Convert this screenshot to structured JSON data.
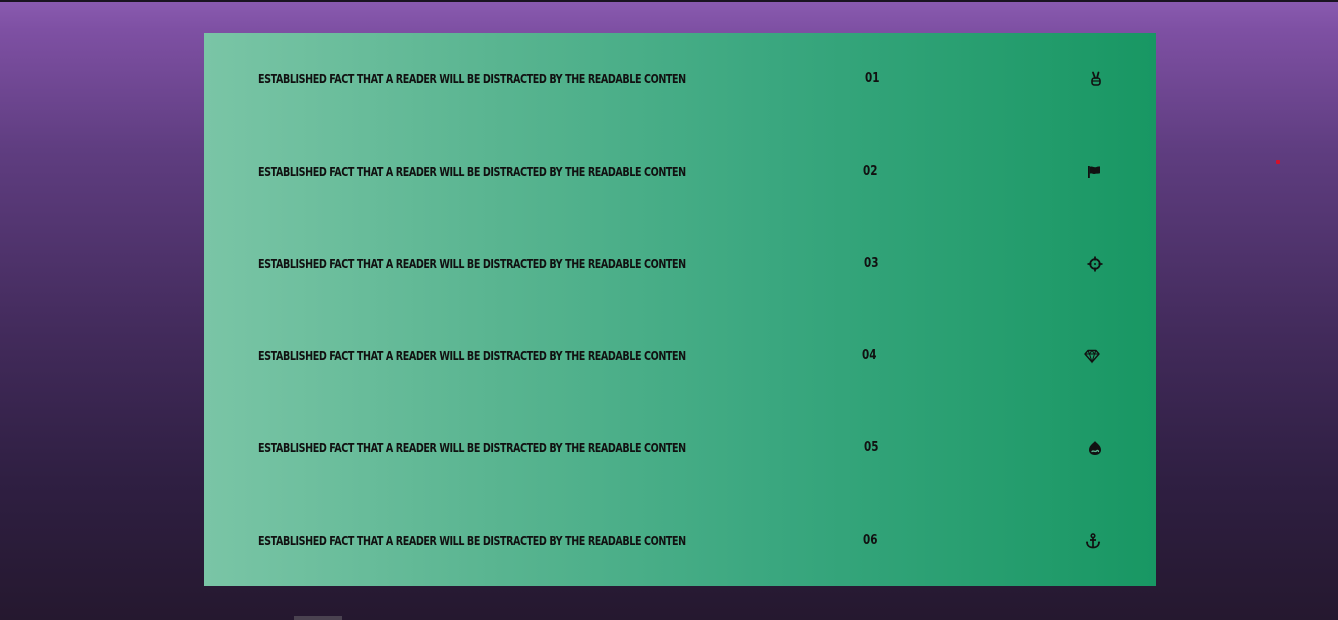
{
  "rows": [
    {
      "text": "ESTABLISHED FACT THAT A READER WILL BE DISTRACTED BY THE READABLE CONTEN",
      "number": "01",
      "icon": "peace-hand-icon"
    },
    {
      "text": "ESTABLISHED FACT THAT A READER WILL BE DISTRACTED BY THE READABLE CONTEN",
      "number": "02",
      "icon": "flag-icon"
    },
    {
      "text": "ESTABLISHED FACT THAT A READER WILL BE DISTRACTED BY THE READABLE CONTEN",
      "number": "03",
      "icon": "crosshairs-icon"
    },
    {
      "text": "ESTABLISHED FACT THAT A READER WILL BE DISTRACTED BY THE READABLE CONTEN",
      "number": "04",
      "icon": "gem-icon"
    },
    {
      "text": "ESTABLISHED FACT THAT A READER WILL BE DISTRACTED BY THE READABLE CONTEN",
      "number": "05",
      "icon": "drupal-icon"
    },
    {
      "text": "ESTABLISHED FACT THAT A READER WILL BE DISTRACTED BY THE READABLE CONTEN",
      "number": "06",
      "icon": "anchor-icon"
    }
  ],
  "colors": {
    "panel_start": "#7ac5a6",
    "panel_end": "#189763",
    "background_top": "#8a5bb0",
    "background_bottom": "#25182f",
    "text": "#111111"
  }
}
